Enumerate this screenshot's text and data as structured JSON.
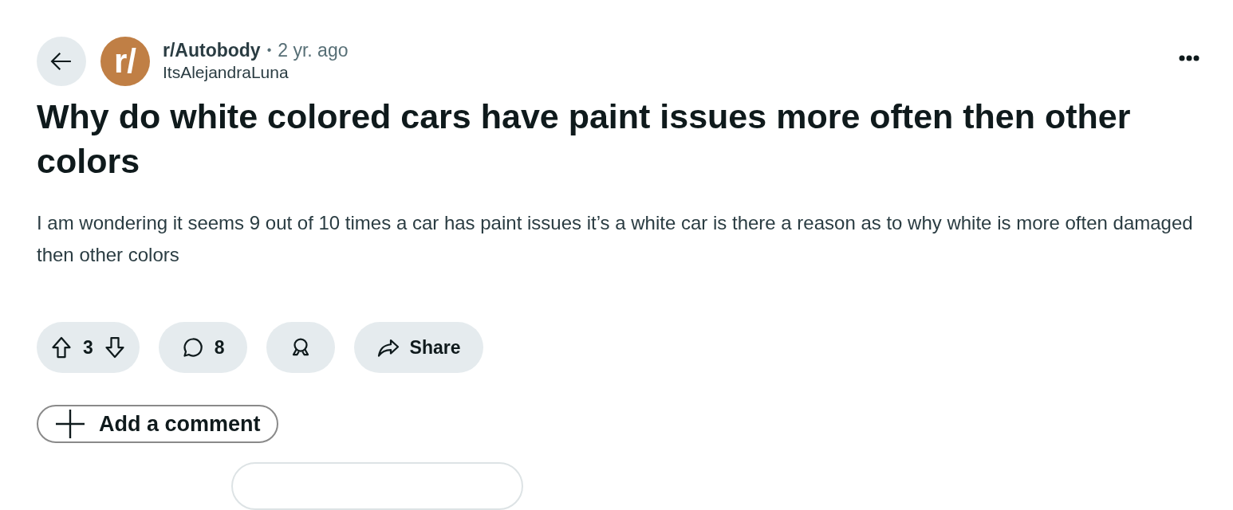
{
  "post": {
    "subreddit": "r/Autobody",
    "avatar_text": "r/",
    "separator": "•",
    "age": "2 yr. ago",
    "author": "ItsAlejandraLuna",
    "title": "Why do white colored cars have paint issues more often then other colors",
    "body": "I am wondering it seems 9 out of 10 times a car has paint issues it’s a white car is there a reason as to why white is more often damaged then other colors"
  },
  "actions": [
    {
      "kind": "vote",
      "label": "3"
    },
    {
      "kind": "comments",
      "label": "8"
    },
    {
      "kind": "award"
    },
    {
      "kind": "share",
      "label": "Share"
    }
  ],
  "add_comment": {
    "label": "Add a comment"
  }
}
